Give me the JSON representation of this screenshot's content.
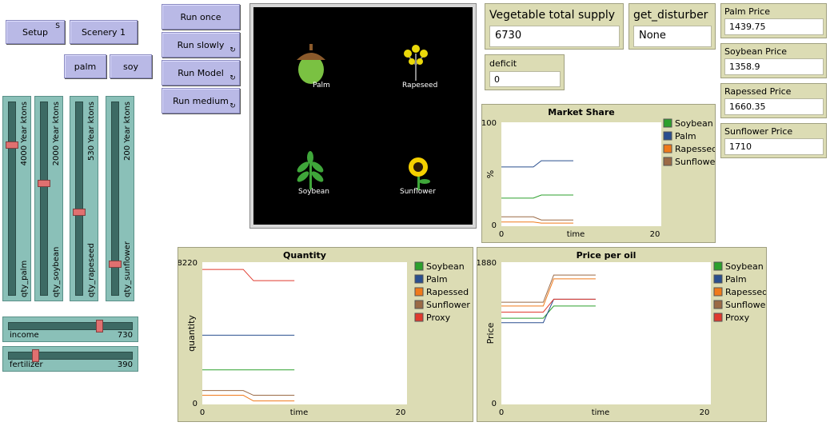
{
  "buttons": {
    "setup": {
      "label": "Setup",
      "key": "S"
    },
    "scenery1": "Scenery 1",
    "palm": "palm",
    "soy": "soy",
    "run_once": "Run once",
    "run_slowly": "Run slowly",
    "run_model": "Run Model",
    "run_medium": "Run medium"
  },
  "sliders_vertical": [
    {
      "name": "qty_palm",
      "display": "4000 Year ktons",
      "fraction": 0.77
    },
    {
      "name": "qty_soybean",
      "display": "2000 Year ktons",
      "fraction": 0.57
    },
    {
      "name": "qty_rapeseed",
      "display": "530 Year ktons",
      "fraction": 0.4
    },
    {
      "name": "qty_sunflower",
      "display": "200 Year ktons",
      "fraction": 0.16
    }
  ],
  "sliders_horizontal": [
    {
      "name": "income",
      "value": "730",
      "fraction": 0.72
    },
    {
      "name": "fertilizer",
      "value": "390",
      "fraction": 0.22
    }
  ],
  "world": {
    "labels": [
      "Palm",
      "Rapeseed",
      "Soybean",
      "Sunflower"
    ]
  },
  "monitors": {
    "vegetable_total_supply": {
      "label": "Vegetable total supply",
      "value": "6730"
    },
    "get_disturber": {
      "label": "get_disturber",
      "value": "None"
    },
    "deficit": {
      "label": "deficit",
      "value": "0"
    },
    "palm_price": {
      "label": "Palm Price",
      "value": "1439.75"
    },
    "soybean_price": {
      "label": "Soybean Price",
      "value": "1358.9"
    },
    "rapessed_price": {
      "label": "Rapessed Price",
      "value": "1660.35"
    },
    "sunflower_price": {
      "label": "Sunflower Price",
      "value": "1710"
    }
  },
  "colors": {
    "soybean": "#2ca02c",
    "palm": "#2a4f8f",
    "rapessed": "#f07a1a",
    "sunflower": "#9b6a45",
    "proxy": "#e03a2e"
  },
  "chart_data": [
    {
      "type": "line",
      "title": "Market Share",
      "xlabel": "time",
      "ylabel": "%",
      "xlim": [
        0,
        20
      ],
      "ylim": [
        0,
        100
      ],
      "x": [
        0,
        4,
        5,
        9
      ],
      "series": [
        {
          "name": "Soybean",
          "values": [
            27,
            27,
            30,
            30
          ]
        },
        {
          "name": "Palm",
          "values": [
            57,
            57,
            63,
            63
          ]
        },
        {
          "name": "Rapessed",
          "values": [
            4,
            4,
            3,
            3
          ]
        },
        {
          "name": "Sunflower",
          "values": [
            9,
            9,
            6,
            6
          ]
        }
      ]
    },
    {
      "type": "line",
      "title": "Quantity",
      "xlabel": "time",
      "ylabel": "quantity",
      "xlim": [
        0,
        20
      ],
      "ylim": [
        0,
        8220
      ],
      "x": [
        0,
        4,
        5,
        9
      ],
      "series": [
        {
          "name": "Soybean",
          "values": [
            2000,
            2000,
            2000,
            2000
          ]
        },
        {
          "name": "Palm",
          "values": [
            4000,
            4000,
            4000,
            4000
          ]
        },
        {
          "name": "Rapessed",
          "values": [
            530,
            530,
            200,
            200
          ]
        },
        {
          "name": "Sunflower",
          "values": [
            800,
            800,
            530,
            530
          ]
        },
        {
          "name": "Proxy",
          "values": [
            7800,
            7800,
            7150,
            7150
          ]
        }
      ]
    },
    {
      "type": "line",
      "title": "Price per oil",
      "xlabel": "time",
      "ylabel": "Price",
      "xlim": [
        0,
        20
      ],
      "ylim": [
        0,
        1880
      ],
      "x": [
        0,
        4,
        5,
        9
      ],
      "series": [
        {
          "name": "Soybean",
          "values": [
            1140,
            1140,
            1300,
            1300
          ]
        },
        {
          "name": "Palm",
          "values": [
            1080,
            1080,
            1390,
            1390
          ]
        },
        {
          "name": "Rapessed",
          "values": [
            1300,
            1300,
            1660,
            1660
          ]
        },
        {
          "name": "Sunflower",
          "values": [
            1350,
            1350,
            1710,
            1710
          ]
        },
        {
          "name": "Proxy",
          "values": [
            1220,
            1220,
            1390,
            1390
          ]
        }
      ]
    }
  ]
}
